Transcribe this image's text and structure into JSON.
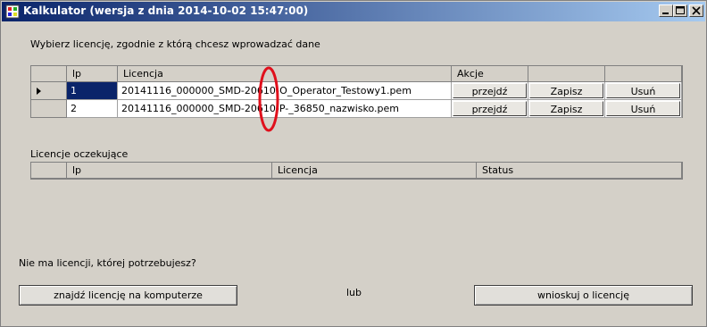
{
  "window": {
    "title": "Kalkulator (wersja z dnia 2014-10-02 15:47:00)",
    "controls": [
      "0",
      "1",
      "r"
    ]
  },
  "instruction": "Wybierz licencję, zgodnie z którą chcesz wprowadzać dane",
  "licenses_table": {
    "columns": [
      "lp",
      "Licencja",
      "Akcje",
      "",
      ""
    ],
    "rows": [
      {
        "lp": "1",
        "license": "20141116_000000_SMD-20610-O_Operator_Testowy1.pem",
        "go": "przejdź",
        "save": "Zapisz",
        "delete": "Usuń",
        "selected": true
      },
      {
        "lp": "2",
        "license": "20141116_000000_SMD-20610-P-_36850_nazwisko.pem",
        "go": "przejdź",
        "save": "Zapisz",
        "delete": "Usuń",
        "selected": false
      }
    ]
  },
  "pending_label": "Licencje oczekujące",
  "pending_table": {
    "columns": [
      "lp",
      "Licencja",
      "Status"
    ],
    "rows": []
  },
  "missing_question": "Nie ma licencji, której potrzebujesz?",
  "find_button": "znajdź licencję na komputerze",
  "or_label": "lub",
  "request_button": "wnioskuj o licencję",
  "colors": {
    "title_start": "#0a246a",
    "title_end": "#a6caf0",
    "selection": "#0a246a",
    "annotation": "#e0101c"
  }
}
